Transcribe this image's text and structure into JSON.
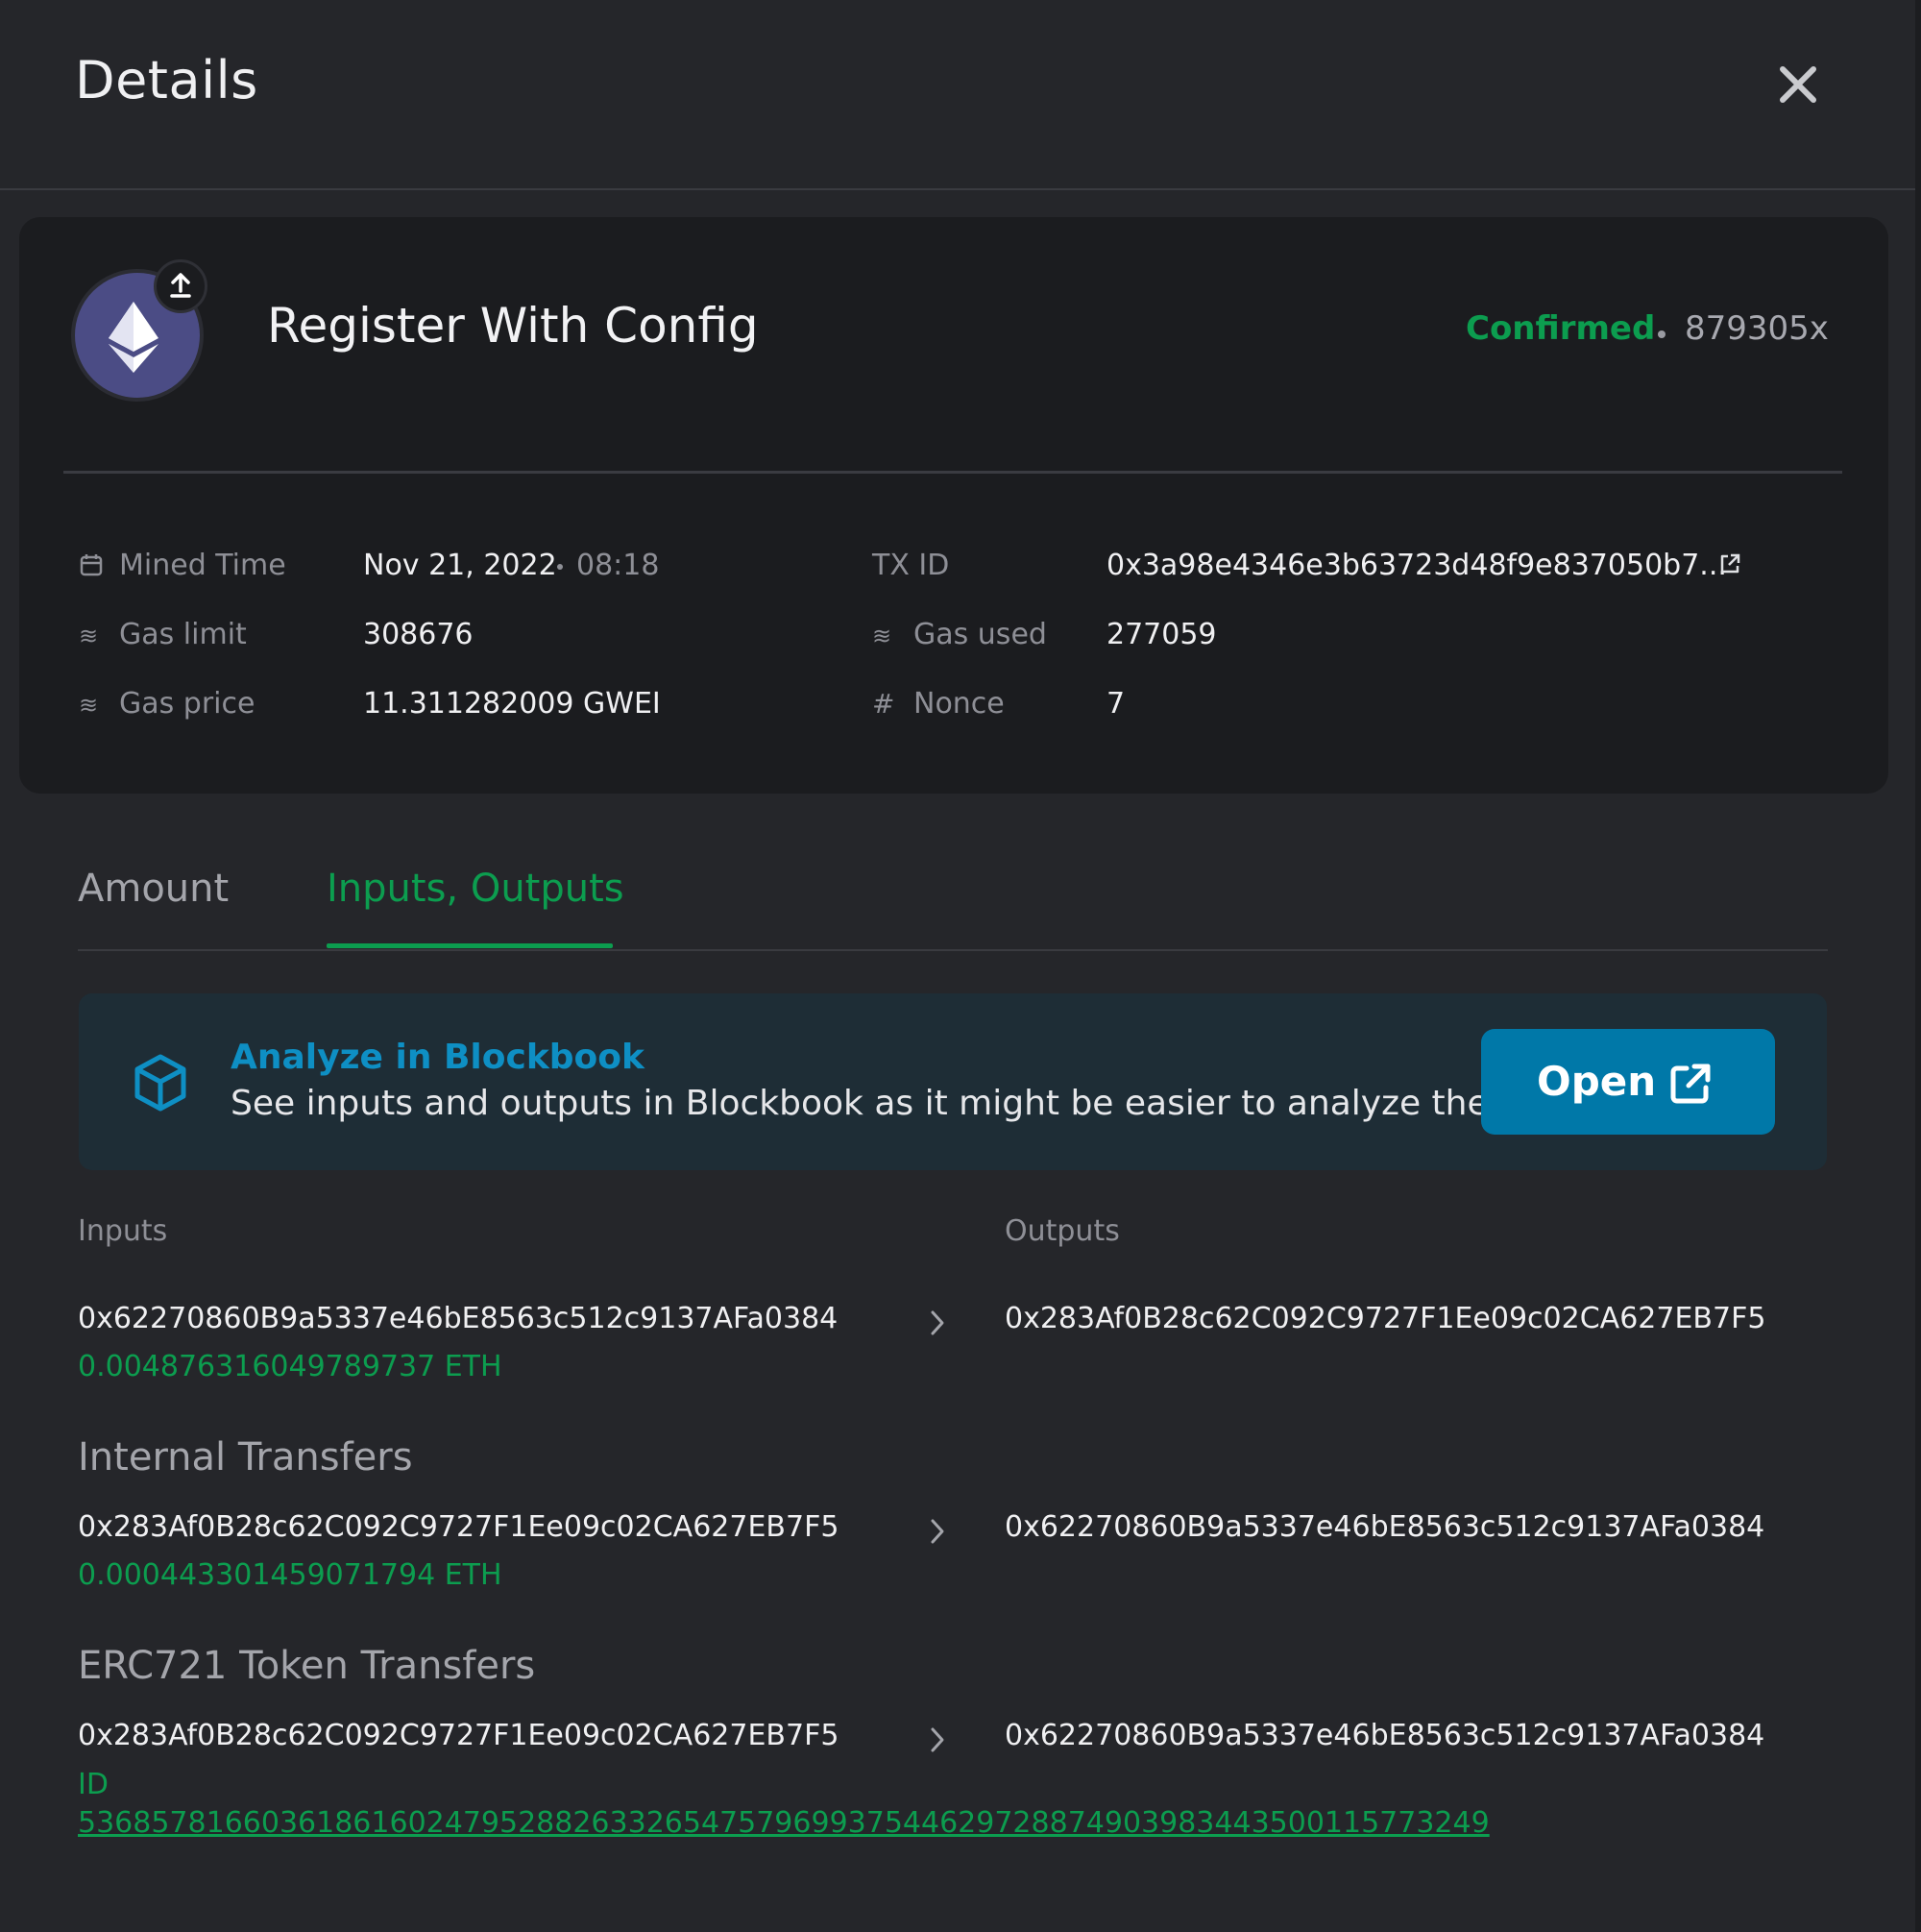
{
  "header": {
    "title": "Details"
  },
  "transaction": {
    "title": "Register With Config",
    "status": "Confirmed",
    "confirmations": "879305x",
    "details": {
      "mined_time_label": "Mined Time",
      "mined_date": "Nov 21, 2022",
      "mined_time": "08:18",
      "txid_label": "TX ID",
      "txid": "0x3a98e4346e3b63723d48f9e837050b7...",
      "gas_limit_label": "Gas limit",
      "gas_limit": "308676",
      "gas_used_label": "Gas used",
      "gas_used": "277059",
      "gas_price_label": "Gas price",
      "gas_price": "11.311282009 GWEI",
      "nonce_label": "Nonce",
      "nonce": "7"
    }
  },
  "tabs": [
    {
      "label": "Amount",
      "active": false
    },
    {
      "label": "Inputs, Outputs",
      "active": true
    }
  ],
  "banner": {
    "title": "Analyze in Blockbook",
    "description": "See inputs and outputs in Blockbook as it might be easier to analyze there",
    "button_label": "Open"
  },
  "io": {
    "inputs_label": "Inputs",
    "outputs_label": "Outputs",
    "main": {
      "from": "0x62270860B9a5337e46bE8563c512c9137AFa0384",
      "amount": "0.004876316049789737 ETH",
      "to": "0x283Af0B28c62C092C9727F1Ee09c02CA627EB7F5"
    },
    "internal": {
      "title": "Internal Transfers",
      "from": "0x283Af0B28c62C092C9727F1Ee09c02CA627EB7F5",
      "amount": "0.000443301459071794 ETH",
      "to": "0x62270860B9a5337e46bE8563c512c9137AFa0384"
    },
    "erc721": {
      "title": "ERC721 Token Transfers",
      "from": "0x283Af0B28c62C092C9727F1Ee09c02CA627EB7F5",
      "to": "0x62270860B9a5337e46bE8563c512c9137AFa0384",
      "id_label": "ID",
      "id_value": "53685781660361861602479528826332654757969937544629728874903983443500115773249"
    }
  },
  "colors": {
    "accent_green": "#0c9d4f",
    "accent_blue": "#0078a8",
    "background": "#25262a",
    "card": "#1b1c1f"
  }
}
